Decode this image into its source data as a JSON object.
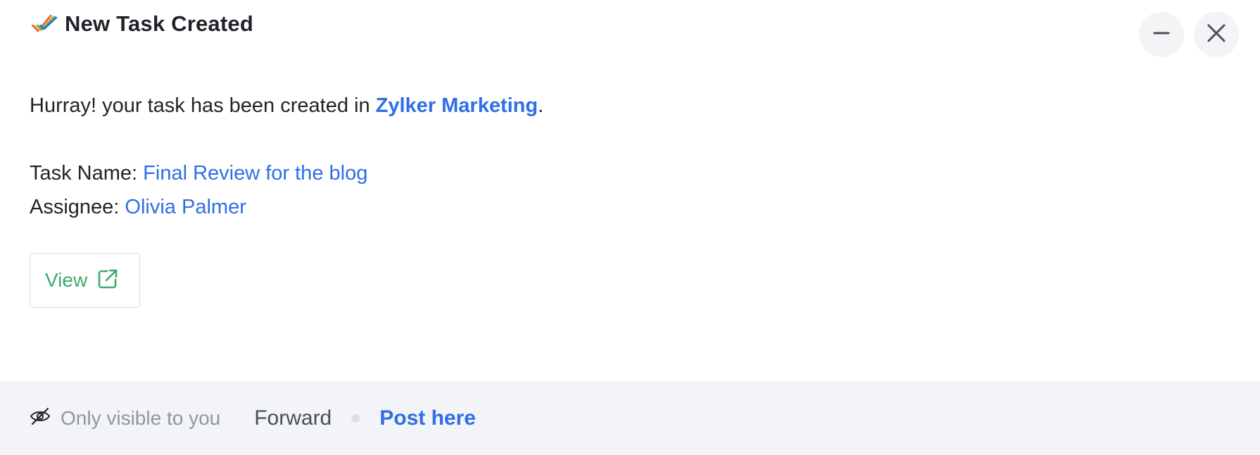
{
  "header": {
    "title": "New Task Created",
    "icon": "double-check-icon"
  },
  "window_controls": {
    "minimize_icon": "minimize-icon",
    "close_icon": "close-icon"
  },
  "message": {
    "prefix": "Hurray! your task has been created in ",
    "project_name": "Zylker Marketing",
    "suffix": ".",
    "task_name_label": "Task Name: ",
    "task_name_value": "Final Review for the blog",
    "assignee_label": "Assignee: ",
    "assignee_value": "Olivia Palmer"
  },
  "view_button": {
    "label": "View",
    "icon": "external-link-icon"
  },
  "footer": {
    "visibility_icon": "eye-off-icon",
    "visibility_text": "Only visible to you",
    "forward_label": "Forward",
    "post_label": "Post here"
  },
  "colors": {
    "link": "#2f6ee6",
    "view_green": "#3cab6a",
    "footer_bg": "#f3f4f7",
    "title": "#1f2329"
  }
}
